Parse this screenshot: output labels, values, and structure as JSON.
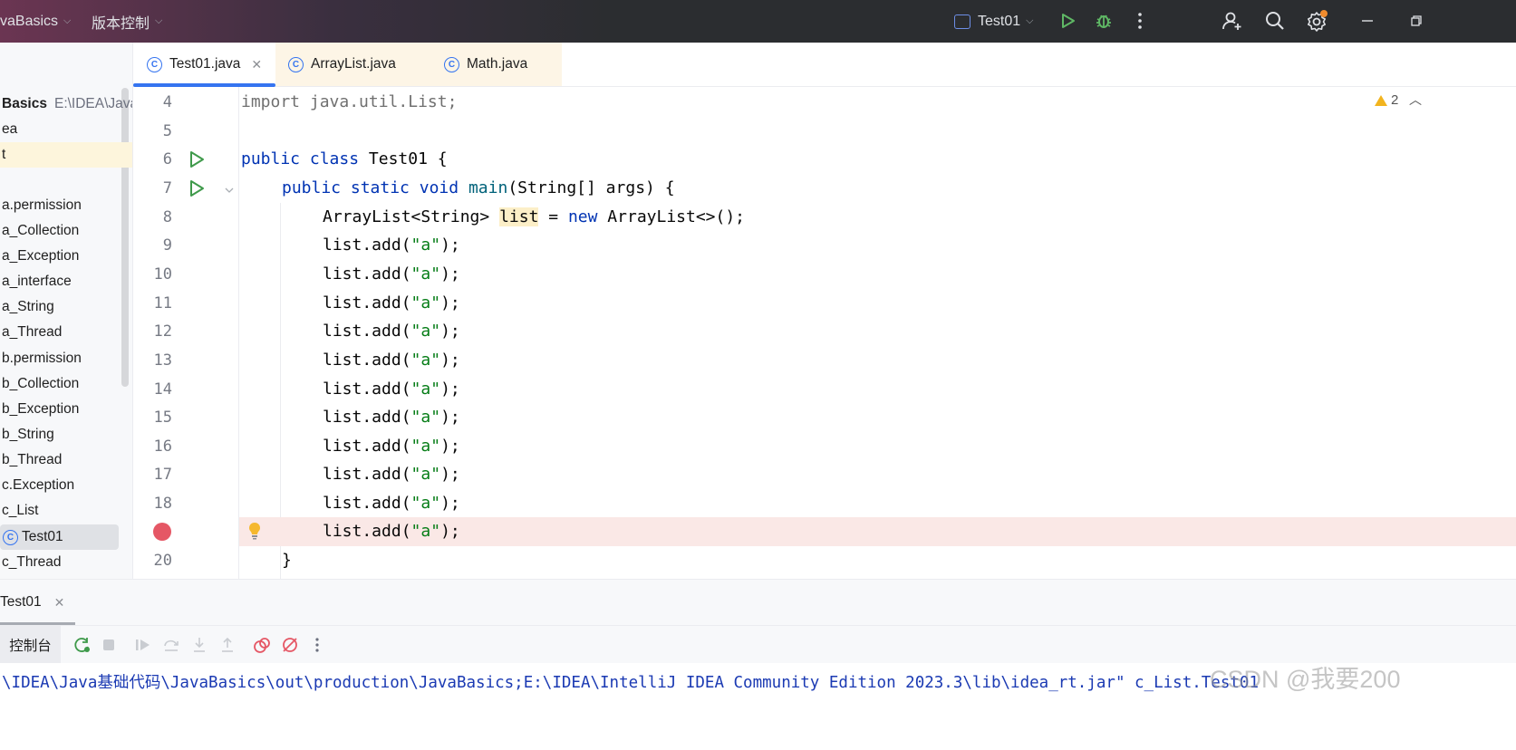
{
  "titlebar": {
    "project": "vaBasics",
    "vcs": "版本控制",
    "run_config": "Test01"
  },
  "sidebar": {
    "root_name": "Basics",
    "root_path": "E:\\IDEA\\Java",
    "items": [
      {
        "label": "ea"
      },
      {
        "label": "t"
      },
      {
        "label": ""
      },
      {
        "label": "a.permission"
      },
      {
        "label": "a_Collection"
      },
      {
        "label": "a_Exception"
      },
      {
        "label": "a_interface"
      },
      {
        "label": "a_String"
      },
      {
        "label": "a_Thread"
      },
      {
        "label": "b.permission"
      },
      {
        "label": "b_Collection"
      },
      {
        "label": "b_Exception"
      },
      {
        "label": "b_String"
      },
      {
        "label": "b_Thread"
      },
      {
        "label": "c.Exception"
      },
      {
        "label": "c_List"
      },
      {
        "label": "Test01"
      },
      {
        "label": "c_Thread"
      }
    ]
  },
  "tabs": [
    {
      "label": "Test01.java",
      "active": true
    },
    {
      "label": "ArrayList.java",
      "active": false
    },
    {
      "label": "Math.java",
      "active": false
    }
  ],
  "editor": {
    "warning_count": "2",
    "lines": [
      {
        "n": "4"
      },
      {
        "n": "5"
      },
      {
        "n": "6"
      },
      {
        "n": "7"
      },
      {
        "n": "8"
      },
      {
        "n": "9"
      },
      {
        "n": "10"
      },
      {
        "n": "11"
      },
      {
        "n": "12"
      },
      {
        "n": "13"
      },
      {
        "n": "14"
      },
      {
        "n": "15"
      },
      {
        "n": "16"
      },
      {
        "n": "17"
      },
      {
        "n": "18"
      },
      {
        "n": ""
      },
      {
        "n": "20"
      }
    ],
    "tokens": {
      "import_line": "import java.util.List;",
      "public": "public",
      "class": "class",
      "class_name": " Test01 {",
      "static": "static",
      "void": "void",
      "main": "main",
      "main_sig": "(String[] args) {",
      "arraylist_decl": "ArrayList<String> ",
      "list_var": "list",
      "assign": " = ",
      "new": "new",
      "arraylist_ctor": " ArrayList<>();",
      "add_prefix": "list.add(",
      "add_arg": "\"a\"",
      "add_suffix": ");",
      "close_brace": "}"
    }
  },
  "debug": {
    "tab_label": "Test01",
    "console_label": "控制台",
    "console_line": "\\IDEA\\Java基础代码\\JavaBasics\\out\\production\\JavaBasics;E:\\IDEA\\IntelliJ IDEA Community Edition 2023.3\\lib\\idea_rt.jar\" c_List.Test01"
  },
  "watermark": "CSDN @我要200"
}
